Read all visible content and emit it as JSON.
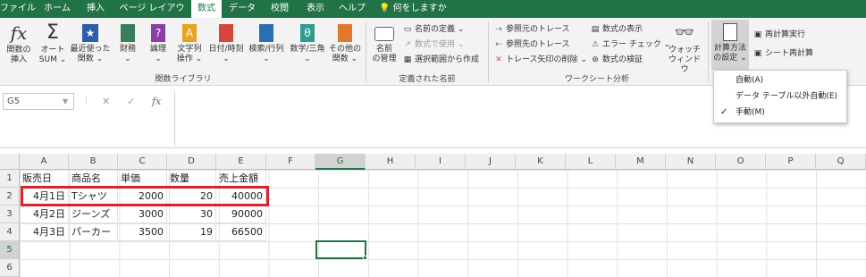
{
  "tabs": [
    "ファイル",
    "ホーム",
    "挿入",
    "ページ レイアウト",
    "数式",
    "データ",
    "校閲",
    "表示",
    "ヘルプ"
  ],
  "active_tab": "数式",
  "tell_me": "何をしますか",
  "ribbon": {
    "function_library": {
      "group_label": "関数ライブラリ",
      "insert_function": "関数の\n挿入",
      "autosum": "オート\nSUM ⌄",
      "recent": "最近使った\n関数 ⌄",
      "financial": "財務\n⌄",
      "logical": "論理\n⌄",
      "text": "文字列\n操作 ⌄",
      "datetime": "日付/時刻\n⌄",
      "lookup": "検索/行列\n⌄",
      "math": "数学/三角\n⌄",
      "more": "その他の\n関数 ⌄"
    },
    "defined_names": {
      "group_label": "定義された名前",
      "name_manager": "名前\nの管理",
      "define_name": "名前の定義 ⌄",
      "use_in_formula": "数式で使用 ⌄",
      "create_from_selection": "選択範囲から作成"
    },
    "formula_auditing": {
      "group_label": "ワークシート分析",
      "trace_precedents": "参照元のトレース",
      "trace_dependents": "参照先のトレース",
      "remove_arrows": "トレース矢印の削除 ⌄",
      "show_formulas": "数式の表示",
      "error_checking": "エラー チェック ⌄",
      "evaluate_formula": "数式の検証",
      "watch_window": "ウォッチ\nウィンドウ"
    },
    "calculation": {
      "calc_options": "計算方法\nの設定 ⌄",
      "calc_now": "再計算実行",
      "calc_sheet": "シート再計算"
    }
  },
  "calc_menu": {
    "items": [
      "自動(A)",
      "データ テーブル以外自動(E)",
      "手動(M)"
    ],
    "checked_index": 2
  },
  "formula_bar": {
    "name_box": "G5",
    "formula": ""
  },
  "columns": [
    "A",
    "B",
    "C",
    "D",
    "E",
    "F",
    "G",
    "H",
    "I",
    "J",
    "K",
    "L",
    "M",
    "N",
    "O",
    "P",
    "Q"
  ],
  "rows": [
    "1",
    "2",
    "3",
    "4",
    "5",
    "6"
  ],
  "selected_cell": {
    "col": "G",
    "row": "5"
  },
  "sheet": {
    "header": [
      "販売日",
      "商品名",
      "単価",
      "数量",
      "売上金額"
    ],
    "data": [
      [
        "4月1日",
        "Tシャツ",
        "2000",
        "20",
        "40000"
      ],
      [
        "4月2日",
        "ジーンズ",
        "3000",
        "30",
        "90000"
      ],
      [
        "4月3日",
        "パーカー",
        "3500",
        "19",
        "66500"
      ]
    ]
  },
  "colors": {
    "excel_green": "#217346",
    "highlight_red": "#d9232e"
  }
}
